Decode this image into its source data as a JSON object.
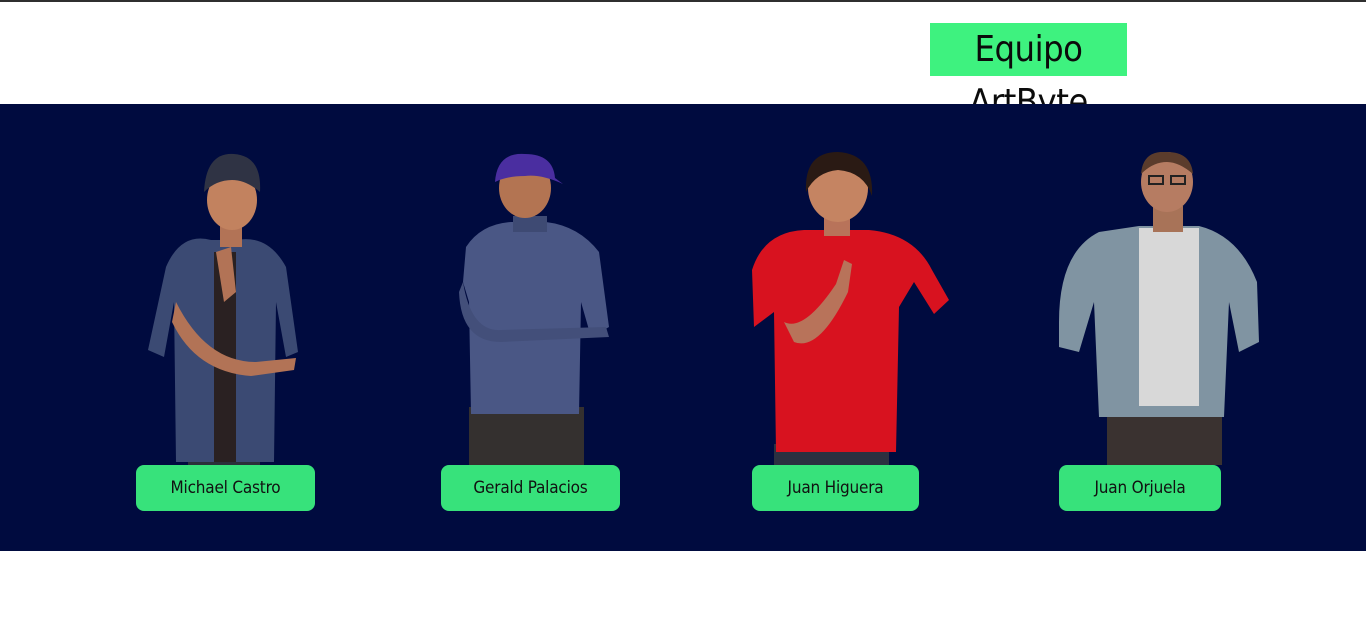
{
  "header": {
    "team_title": "Equipo ArtByte"
  },
  "team": {
    "members": [
      {
        "name": "Michael Castro",
        "photo_icon": "person-photo"
      },
      {
        "name": "Gerald Palacios",
        "photo_icon": "person-photo"
      },
      {
        "name": "Juan Higuera",
        "photo_icon": "person-photo"
      },
      {
        "name": "Juan Orjuela",
        "photo_icon": "person-photo"
      }
    ]
  },
  "colors": {
    "band_background": "#000b3f",
    "accent_green": "#37e27b",
    "title_green": "#3ef27f"
  }
}
